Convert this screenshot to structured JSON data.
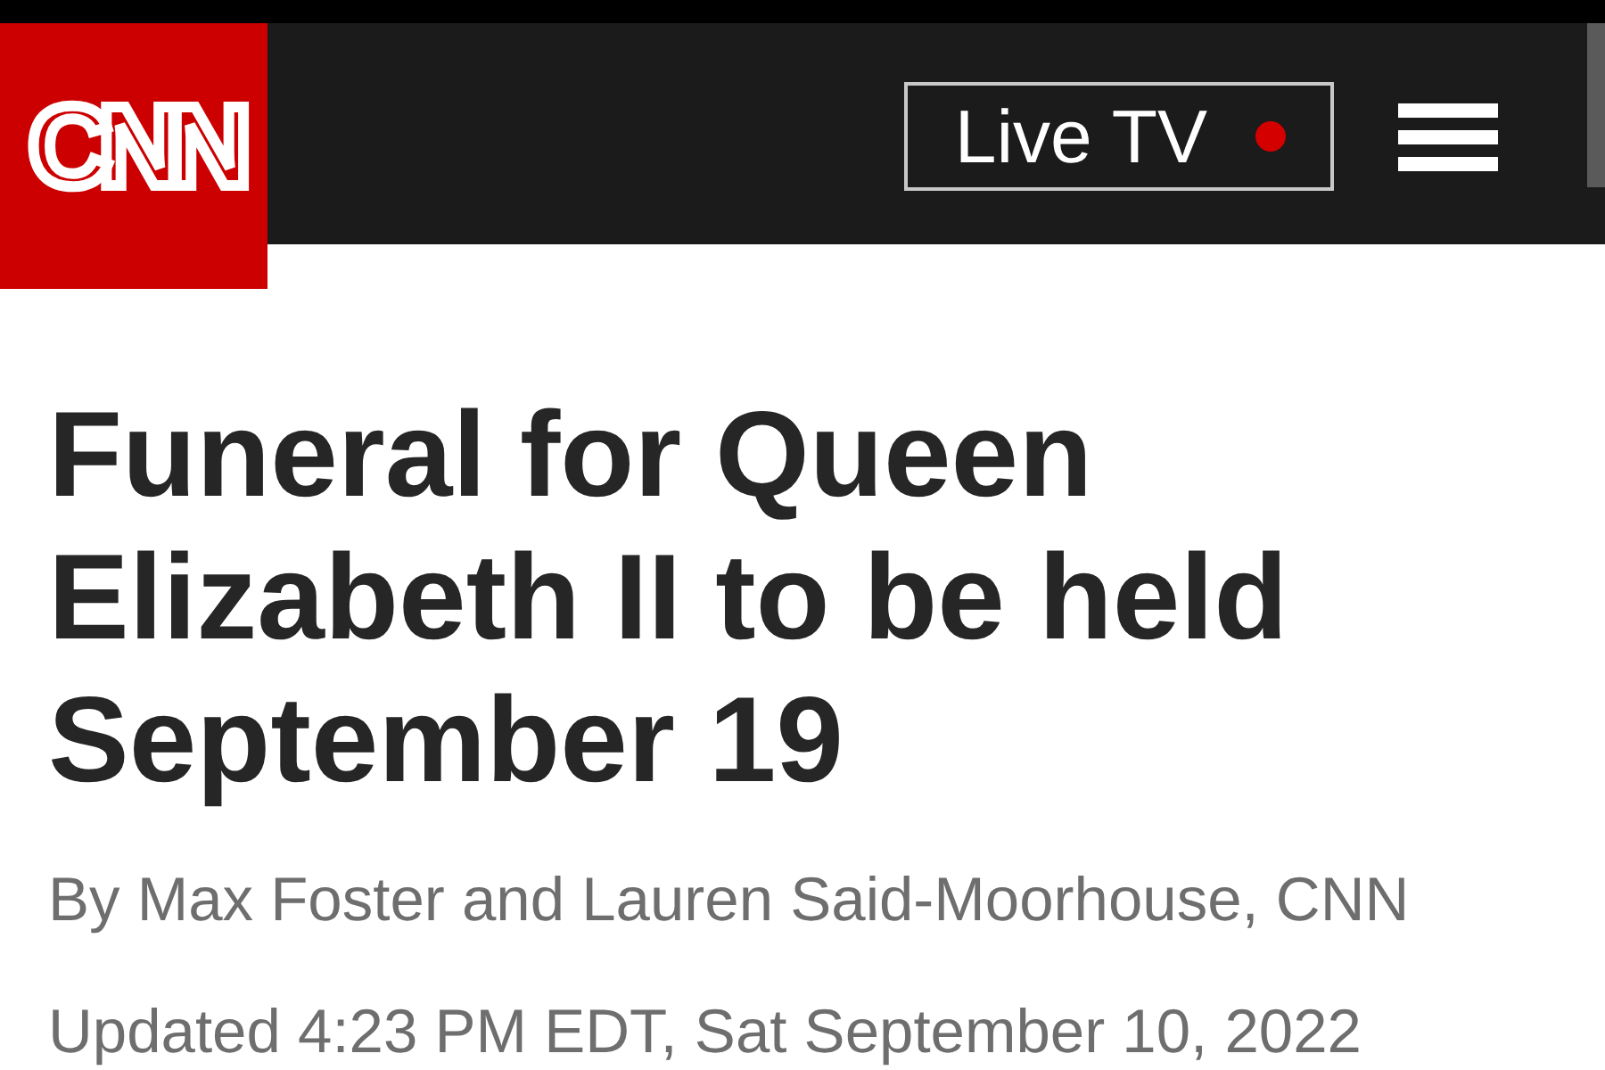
{
  "header": {
    "logo": "CNN",
    "live_tv_button": {
      "label": "Live TV"
    }
  },
  "article": {
    "headline": "Funeral for Queen Elizabeth II to be held September 19",
    "byline": "By Max Foster and Lauren Said-Moorhouse, CNN",
    "updated": "Updated 4:23 PM EDT, Sat September 10, 2022"
  }
}
